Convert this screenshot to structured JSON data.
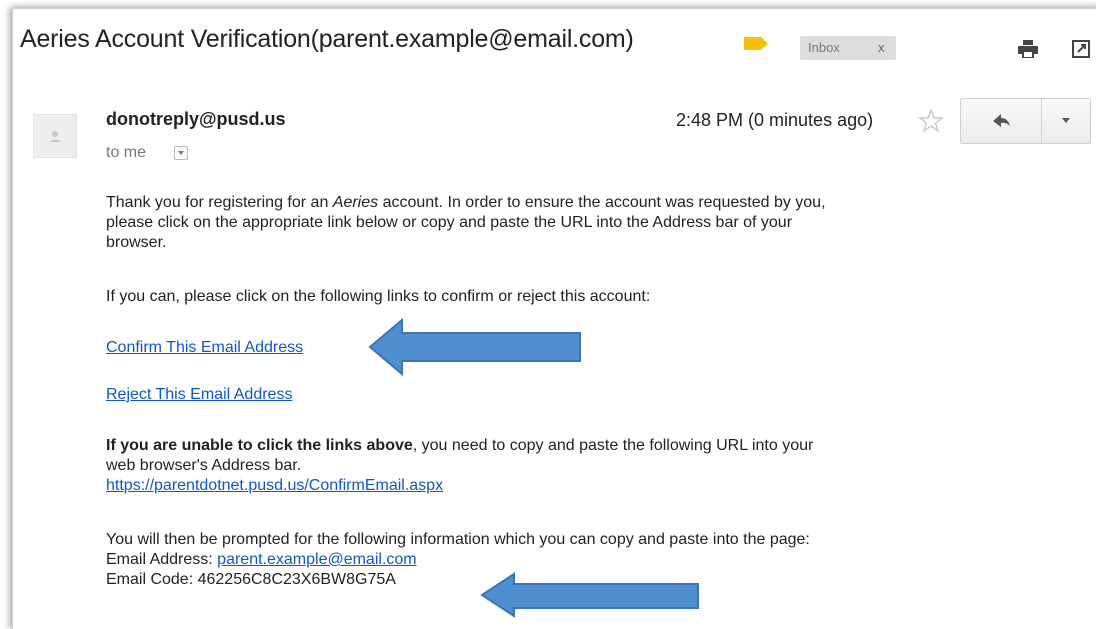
{
  "email": {
    "subject": "Aeries Account Verification(parent.example@email.com)",
    "label": "Inbox",
    "label_close": "x",
    "sender": "donotreply@pusd.us",
    "to_line": "to me",
    "time": "2:48 PM (0 minutes ago)"
  },
  "body": {
    "para1_before": "Thank you for registering for an ",
    "para1_italic": "Aeries",
    "para1_after": " account. In order to ensure the account was requested by you,",
    "para1_line2": "please click on the appropriate link below or copy and paste the URL into the Address bar of your",
    "para1_line3": "browser.",
    "para2": "If you can, please click on the following links to confirm or reject this account:",
    "confirm_link": "Confirm This Email Address",
    "reject_link": "Reject This Email Address",
    "para3_bold": "If you are unable to click the links above",
    "para3_rest": ", you need to copy and paste the following URL into your",
    "para3_line2": "web browser's Address bar.",
    "url_link": "https://parentdotnet.pusd.us/ConfirmEmail.aspx",
    "para4": "You will then be prompted for the following information which you can copy and paste into the page:",
    "email_address_label": "Email Address:",
    "email_address_value": "parent.example@email.com",
    "email_code_label": "Email Code:",
    "email_code_value": "462256C8C23X6BW8G75A"
  },
  "colors": {
    "link": "#1155cc",
    "arrow_fill": "#4f8fd0",
    "importance_marker": "#f4c20d"
  },
  "icons": [
    "importance-marker-icon",
    "print-icon",
    "popout-icon",
    "avatar-icon",
    "star-icon",
    "reply-icon",
    "dropdown-icon",
    "arrow-icon"
  ]
}
